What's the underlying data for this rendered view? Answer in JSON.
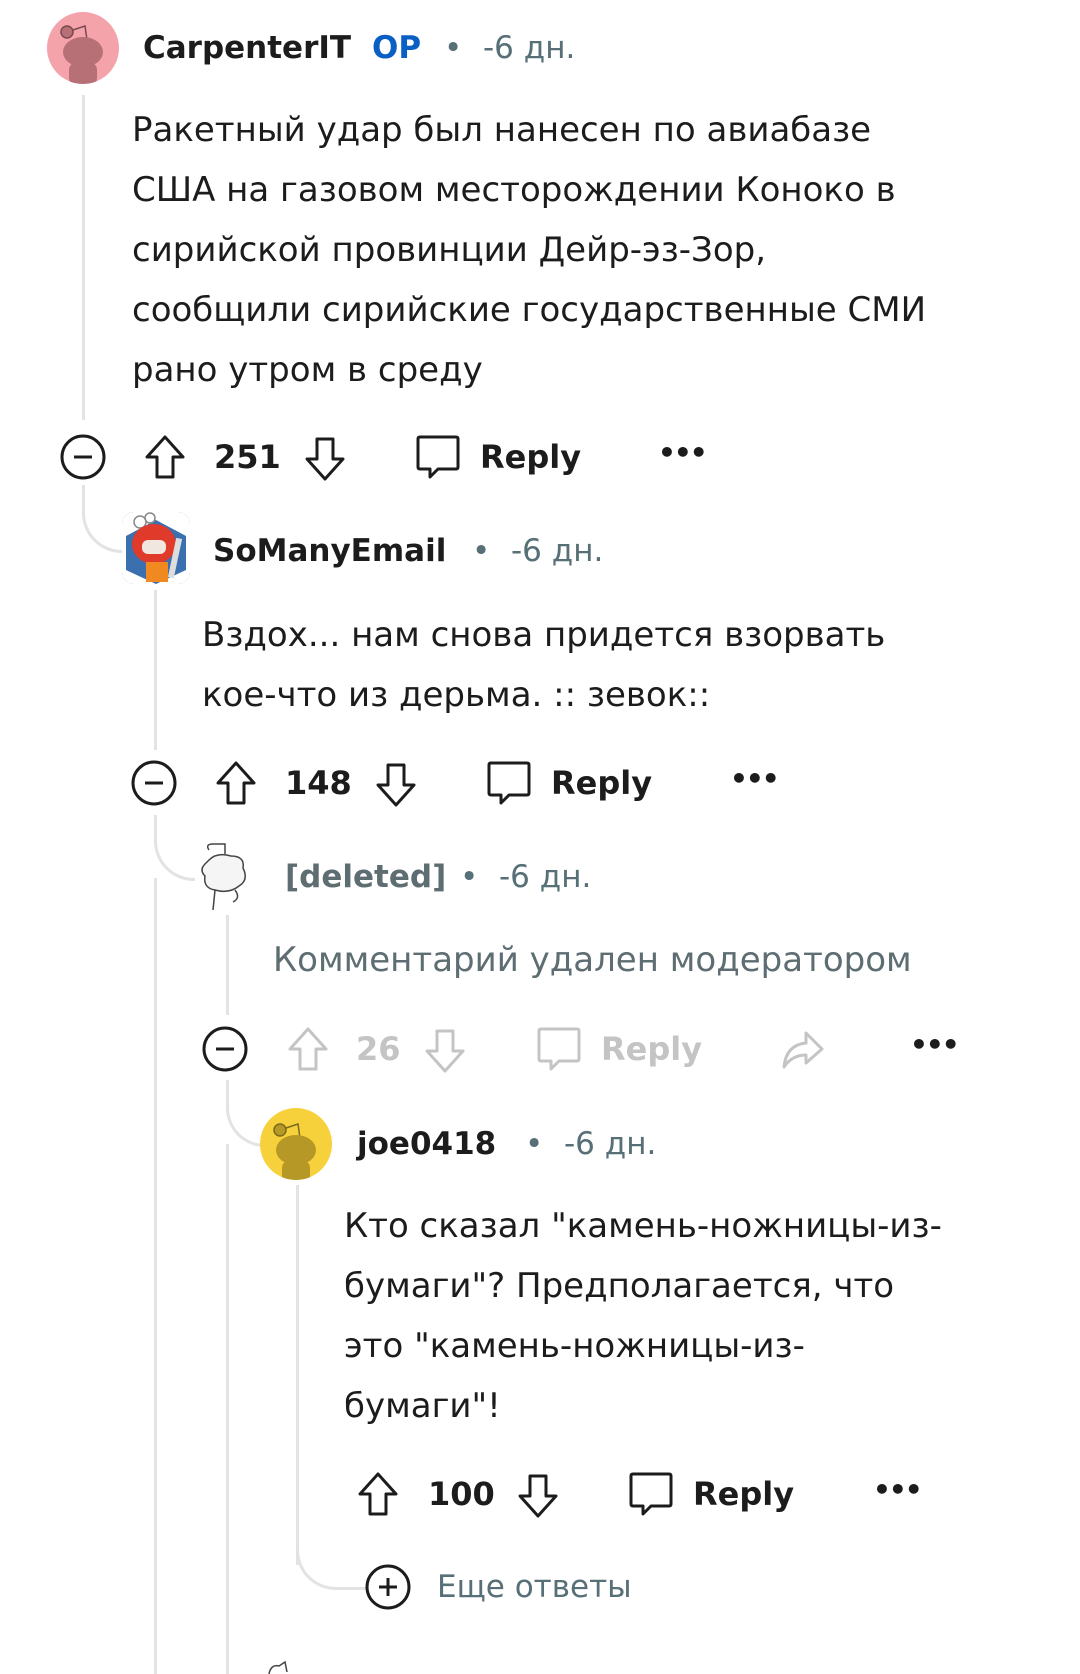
{
  "comments": [
    {
      "author": "CarpenterIT",
      "op_badge": "OP",
      "separator": "•",
      "age": "-6 дн.",
      "avatar": {
        "icon": "snoo-avatar-icon",
        "bg": "#f4a3aa",
        "fg": "#b87077"
      },
      "body_lines": [
        "Ракетный удар был нанесен по авиабазе",
        "США на газовом месторождении Коноко в",
        "сирийской провинции Дейр-эз-Зор,",
        "сообщили сирийские государственные СМИ",
        "рано утром в среду"
      ],
      "score": "251",
      "reply_label": "Reply",
      "more_label": "•••"
    },
    {
      "author": "SoManyEmail",
      "separator": "•",
      "age": "-6 дн.",
      "avatar": {
        "icon": "custom-avatar-icon",
        "bg": "#e03a2a",
        "fg": "#3a6fb0"
      },
      "body_lines": [
        "Вздох... нам снова придется взорвать",
        "кое-что из дерьма. :: зевок::"
      ],
      "score": "148",
      "reply_label": "Reply",
      "more_label": "•••"
    },
    {
      "author": "[deleted]",
      "separator": "•",
      "age": "-6 дн.",
      "avatar": {
        "icon": "deleted-snoo-icon"
      },
      "body_lines": [
        "Комментарий удален модератором"
      ],
      "score": "26",
      "reply_label": "Reply",
      "more_label": "•••"
    },
    {
      "author": "joe0418",
      "separator": "•",
      "age": "-6 дн.",
      "avatar": {
        "icon": "snoo-avatar-icon",
        "bg": "#f7d13c",
        "fg": "#b59826"
      },
      "body_lines": [
        "Кто сказал \"камень-ножницы-из-",
        "бумаги\"? Предполагается, что",
        "это \"камень-ножницы-из-",
        "бумаги\"!"
      ],
      "score": "100",
      "reply_label": "Reply",
      "more_label": "•••"
    }
  ],
  "more_replies_label": "Еще ответы",
  "colors": {
    "op": "#0a5fc5",
    "meta": "#576f76",
    "thread_line": "#e3e3e3",
    "disabled": "#c4c4c4"
  }
}
